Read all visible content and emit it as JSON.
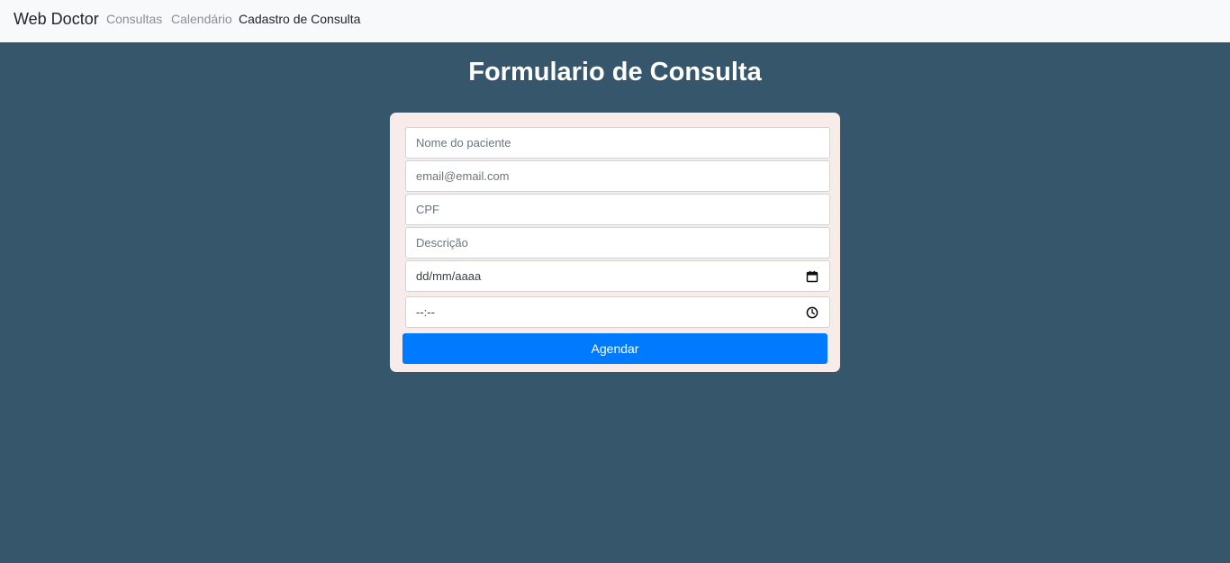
{
  "navbar": {
    "brand": "Web Doctor",
    "links": [
      {
        "label": "Consultas"
      },
      {
        "label": "Calendário"
      },
      {
        "label": "Cadastro de Consulta"
      }
    ]
  },
  "page": {
    "title": "Formulario de Consulta"
  },
  "form": {
    "nome_placeholder": "Nome do paciente",
    "email_placeholder": "email@email.com",
    "cpf_placeholder": "CPF",
    "descricao_placeholder": "Descrição",
    "date_display": "dd/mm/aaaa",
    "time_display": "--:--",
    "date_icon": "calendar-icon",
    "time_icon": "clock-icon",
    "submit_label": "Agendar"
  },
  "colors": {
    "background": "#36576b",
    "navbar": "#f8f9fa",
    "card": "#f7ecea",
    "button": "#007bff"
  }
}
